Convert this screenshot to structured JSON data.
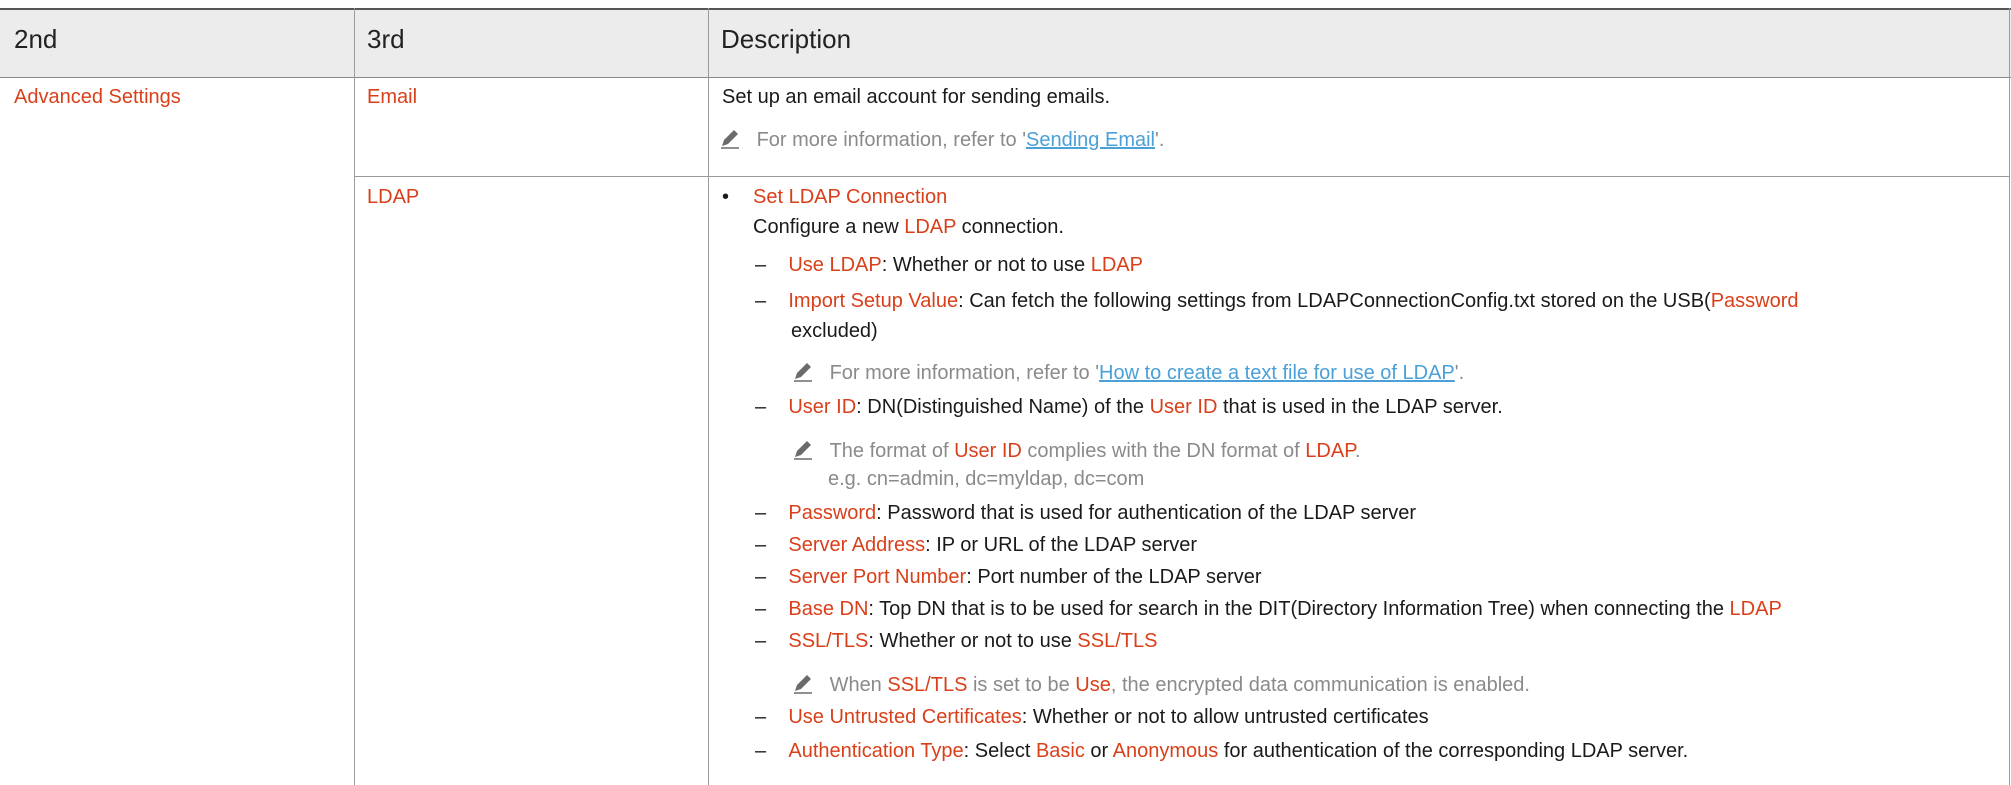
{
  "headers": {
    "col2": "2nd",
    "col3": "3rd",
    "desc": "Description"
  },
  "row1": {
    "second": "Advanced Settings",
    "third": "Email",
    "desc": "Set up an email account for sending emails.",
    "note_prefix": "For more information, refer to '",
    "note_link": "Sending Email",
    "note_suffix": "'."
  },
  "row2": {
    "third": "LDAP",
    "bullet_title": "Set LDAP Connection",
    "intro_a": "Configure a new ",
    "intro_b": "LDAP",
    "intro_c": " connection.",
    "use_ldap": {
      "label": "Use LDAP",
      "text": ": Whether or not to use ",
      "tail": "LDAP"
    },
    "import": {
      "label": "Import Setup Value",
      "text": ": Can fetch the following settings from LDAPConnectionConfig.txt stored on the USB(",
      "pw": "Password",
      "line2": "excluded)"
    },
    "note1": {
      "prefix": "For more information, refer to '",
      "link": "How to create a text file for use of LDAP",
      "suffix": "'."
    },
    "user_id": {
      "label": "User ID",
      "text1": ": DN(Distinguished Name) of the ",
      "label2": "User ID",
      "text2": " that is used in the LDAP server."
    },
    "note2": {
      "a": "The format of ",
      "b": "User ID",
      "c": " complies with the DN format of ",
      "d": "LDAP",
      "e": ".",
      "example": "e.g. cn=admin, dc=myldap, dc=com"
    },
    "password": {
      "label": "Password",
      "text": ": Password that is used for authentication of the LDAP server"
    },
    "server_addr": {
      "label": "Server Address",
      "text": ": IP or URL of the LDAP server"
    },
    "server_port": {
      "label": "Server Port Number",
      "text": ": Port number of the LDAP server"
    },
    "base_dn": {
      "label": "Base DN",
      "text": ": Top DN that is to be used for search in the DIT(Directory Information Tree) when connecting the ",
      "tail": "LDAP"
    },
    "ssl": {
      "label": "SSL/TLS",
      "text": ": Whether or not to use ",
      "tail": "SSL/TLS"
    },
    "note3": {
      "a": "When ",
      "b": "SSL/TLS",
      "c": " is set to be ",
      "d": "Use",
      "e": ", the encrypted data communication is enabled."
    },
    "untrusted": {
      "label": "Use Untrusted Certificates",
      "text": ": Whether or not to allow untrusted certificates"
    },
    "auth": {
      "label": "Authentication Type",
      "t1": ": Select ",
      "basic": "Basic",
      "t2": " or ",
      "anon": "Anonymous",
      "t3": " for authentication of the corresponding LDAP server."
    }
  },
  "icons": {
    "note": "pencil-note-icon"
  },
  "colors": {
    "accent": "#d9401a",
    "note": "#8a8a8a",
    "link": "#4aa0d8",
    "header_bg": "#ececec"
  }
}
